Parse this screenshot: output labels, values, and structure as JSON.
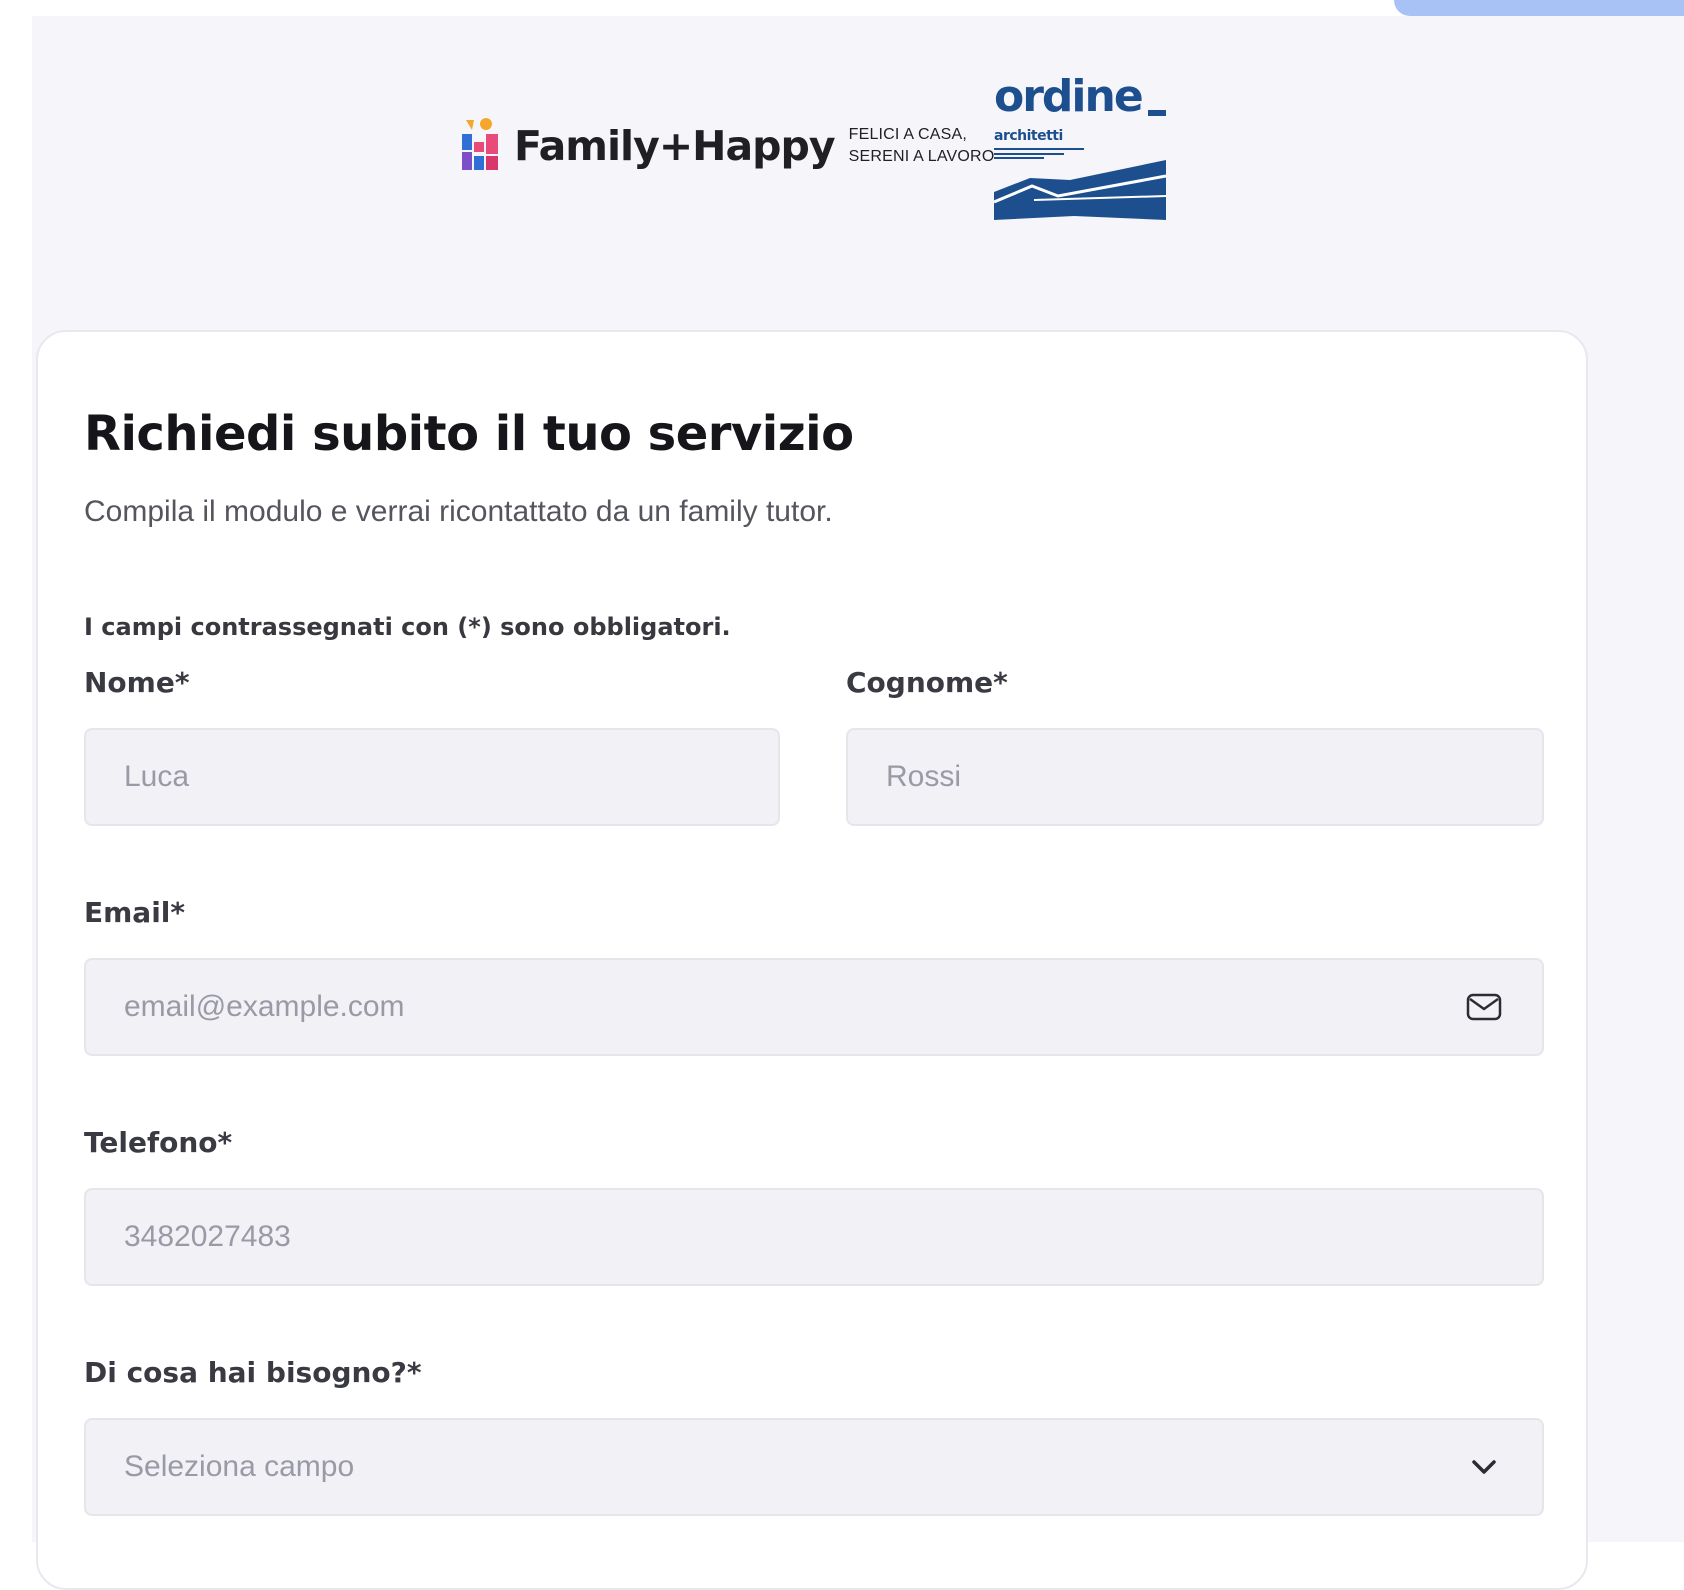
{
  "header": {
    "family_logo_name": "Family+Happy",
    "family_tagline_line1": "FELICI A CASA,",
    "family_tagline_line2": "SERENI A LAVORO",
    "ordine_logo_name": "ordine",
    "ordine_logo_sub": "architetti"
  },
  "form": {
    "title": "Richiedi subito il tuo servizio",
    "subtitle": "Compila il modulo e verrai ricontattato da un family tutor.",
    "required_note": "I campi contrassegnati con (*) sono obbligatori.",
    "fields": {
      "nome": {
        "label": "Nome*",
        "placeholder": "Luca"
      },
      "cognome": {
        "label": "Cognome*",
        "placeholder": "Rossi"
      },
      "email": {
        "label": "Email*",
        "placeholder": "email@example.com",
        "icon": "mail-icon"
      },
      "telefono": {
        "label": "Telefono*",
        "placeholder": "3482027483"
      },
      "bisogno": {
        "label": "Di cosa hai bisogno?*",
        "selected": "Seleziona campo",
        "icon": "chevron-down-icon"
      }
    }
  },
  "colors": {
    "page_background": "#f5f5fa",
    "card_background": "#ffffff",
    "input_background": "#f1f1f6",
    "ordine_blue": "#1d4f8f",
    "accent_blob": "#a8c2f5"
  }
}
